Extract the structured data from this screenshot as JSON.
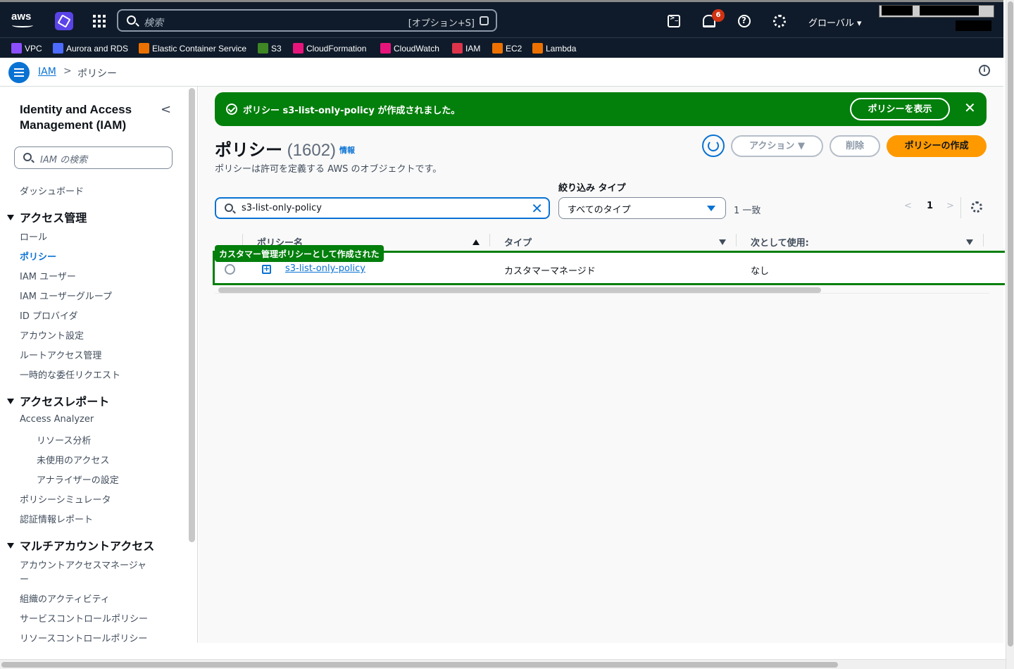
{
  "topnav": {
    "search_placeholder": "検索",
    "search_shortcut": "[オプション+S]",
    "notifications_count": "6",
    "region": "グローバル ▾"
  },
  "favorites": [
    {
      "label": "VPC",
      "color": "#8c4fff"
    },
    {
      "label": "Aurora and RDS",
      "color": "#4d6bff"
    },
    {
      "label": "Elastic Container Service",
      "color": "#ed7100"
    },
    {
      "label": "S3",
      "color": "#3f8624"
    },
    {
      "label": "CloudFormation",
      "color": "#e7157b"
    },
    {
      "label": "CloudWatch",
      "color": "#e7157b"
    },
    {
      "label": "IAM",
      "color": "#dd344c"
    },
    {
      "label": "EC2",
      "color": "#ed7100"
    },
    {
      "label": "Lambda",
      "color": "#ed7100"
    }
  ],
  "breadcrumb": {
    "root": "IAM",
    "separator": ">",
    "current": "ポリシー"
  },
  "sidebar": {
    "title": "Identity and Access Management (IAM)",
    "search_placeholder": "IAM の検索",
    "dashboard": "ダッシュボード",
    "sections": [
      {
        "label": "アクセス管理",
        "items": [
          "ロール",
          "ポリシー",
          "IAM ユーザー",
          "IAM ユーザーグループ",
          "ID プロバイダ",
          "アカウント設定",
          "ルートアクセス管理",
          "一時的な委任リクエスト"
        ]
      },
      {
        "label": "アクセスレポート",
        "items": [
          "Access Analyzer",
          "リソース分析",
          "未使用のアクセス",
          "アナライザーの設定",
          "ポリシーシミュレータ",
          "認証情報レポート"
        ]
      },
      {
        "label": "マルチアカウントアクセス",
        "items": [
          "アカウントアクセスマネージャ",
          "ー",
          "組織のアクティビティ",
          "サービスコントロールポリシー",
          "リソースコントロールポリシー"
        ]
      }
    ]
  },
  "flash": {
    "message": "ポリシー s3-list-only-policy が作成されました。",
    "view_button": "ポリシーを表示",
    "close": "✕"
  },
  "header": {
    "title": "ポリシー",
    "count": "(1602)",
    "info": "情報",
    "description": "ポリシーは許可を定義する AWS のオブジェクトです。",
    "actions_button": "アクション ▼",
    "delete_button": "削除",
    "create_button": "ポリシーの作成"
  },
  "filter": {
    "search_value": "s3-list-only-policy",
    "type_label": "絞り込み タイプ",
    "type_value": "すべてのタイプ",
    "match_count": "1 一致",
    "page_prev": "<",
    "page_current": "1",
    "page_next": ">"
  },
  "table": {
    "columns": [
      "ポリシー名",
      "タイプ",
      "次として使用:"
    ],
    "highlight_tag": "カスタマー管理ポリシーとして作成された",
    "rows": [
      {
        "name": "s3-list-only-policy",
        "type": "カスタマーマネージド",
        "used_as": "なし"
      }
    ]
  }
}
